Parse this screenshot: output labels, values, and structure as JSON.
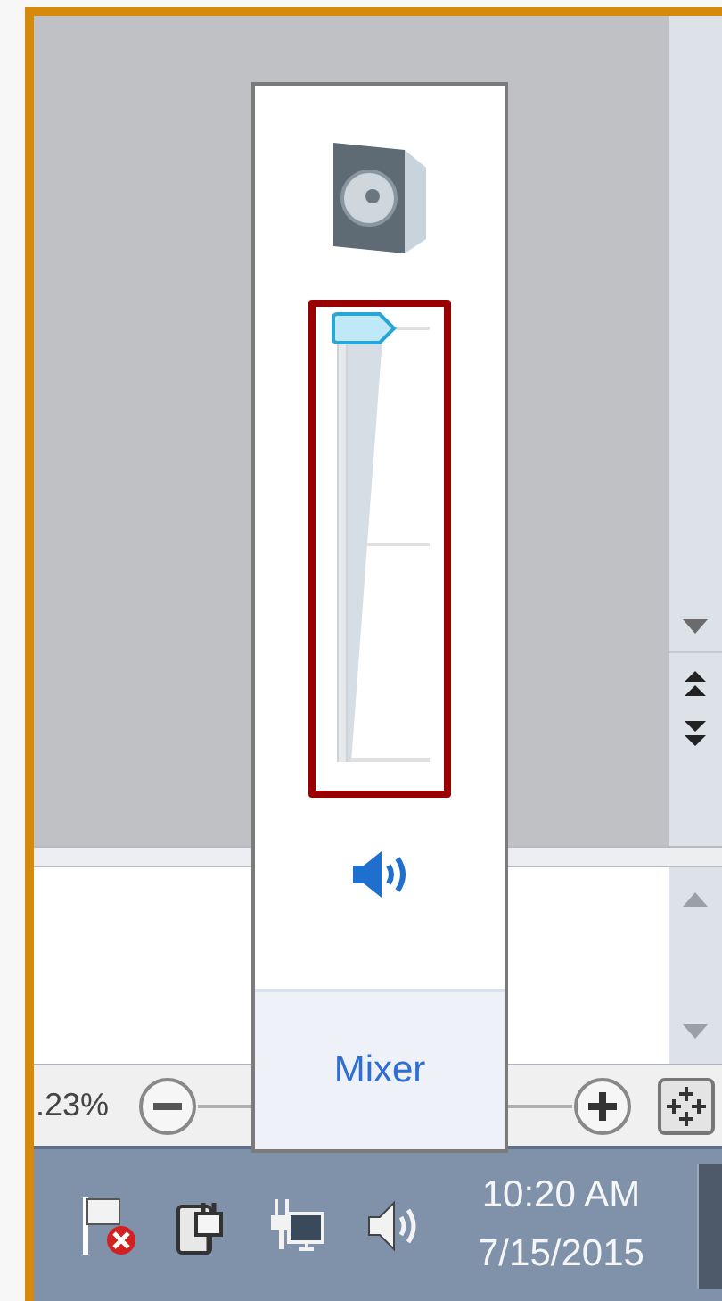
{
  "zoom_bar": {
    "zoom_level": ".23%"
  },
  "volume_popup": {
    "slider": {
      "level": 1.0
    },
    "muted": false,
    "mixer_link": "Mixer"
  },
  "taskbar": {
    "time": "10:20 AM",
    "date": "7/15/2015"
  }
}
